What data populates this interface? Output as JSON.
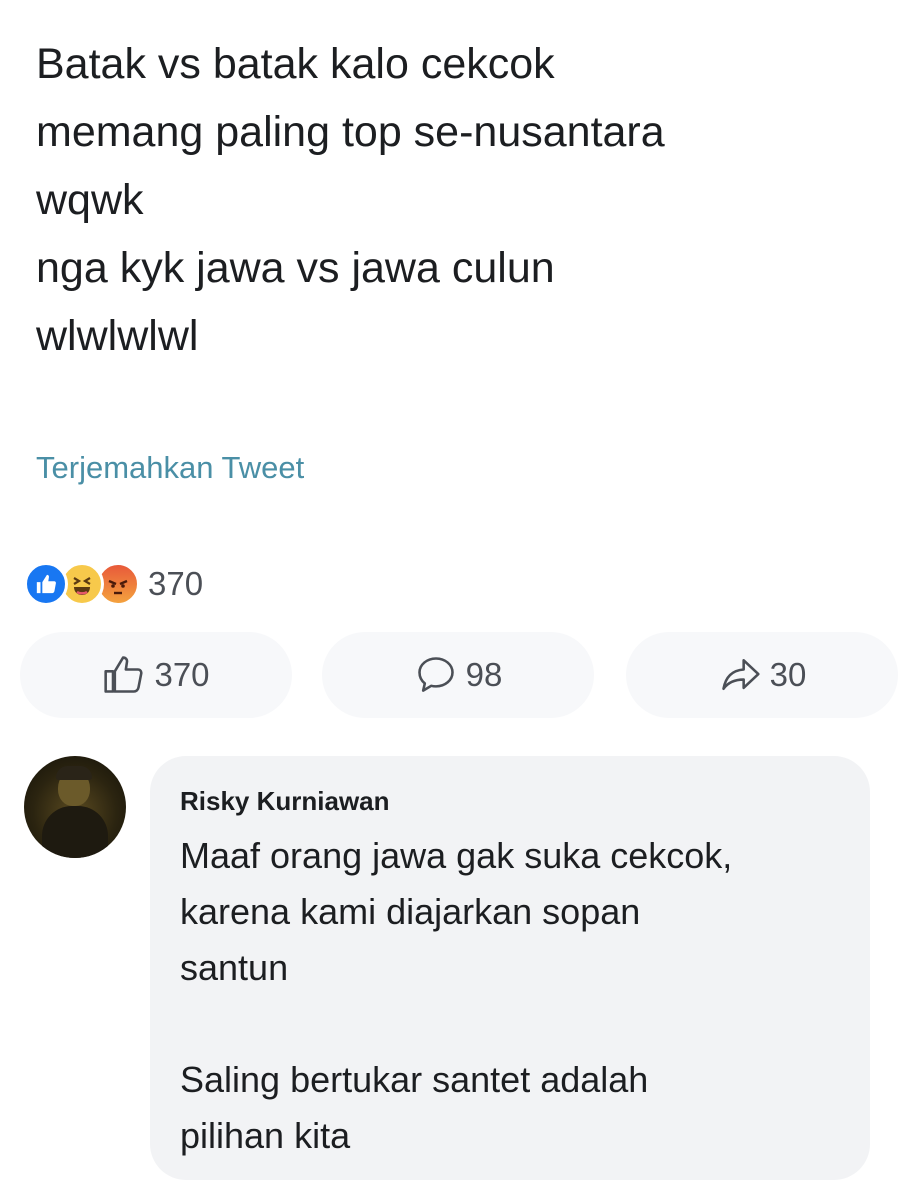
{
  "post": {
    "lines": [
      "Batak vs batak kalo cekcok",
      "memang paling top se-nusantara",
      "wqwk",
      "nga kyk jawa vs jawa culun",
      "wlwlwlwl"
    ],
    "translate_label": "Terjemahkan Tweet"
  },
  "reactions": {
    "icons": [
      "like-reaction-icon",
      "haha-reaction-icon",
      "angry-reaction-icon"
    ],
    "count": "370"
  },
  "actions": {
    "like_count": "370",
    "comment_count": "98",
    "share_count": "30"
  },
  "comment": {
    "author": "Risky Kurniawan",
    "lines": [
      "Maaf orang jawa gak suka cekcok,",
      "karena kami diajarkan sopan",
      "santun",
      "",
      "Saling bertukar santet adalah",
      "pilihan kita"
    ]
  },
  "colors": {
    "link": "#4a8fa6",
    "like_blue": "#1877f2",
    "pill_bg": "#f7f8fa",
    "bubble_bg": "#f2f3f5"
  }
}
